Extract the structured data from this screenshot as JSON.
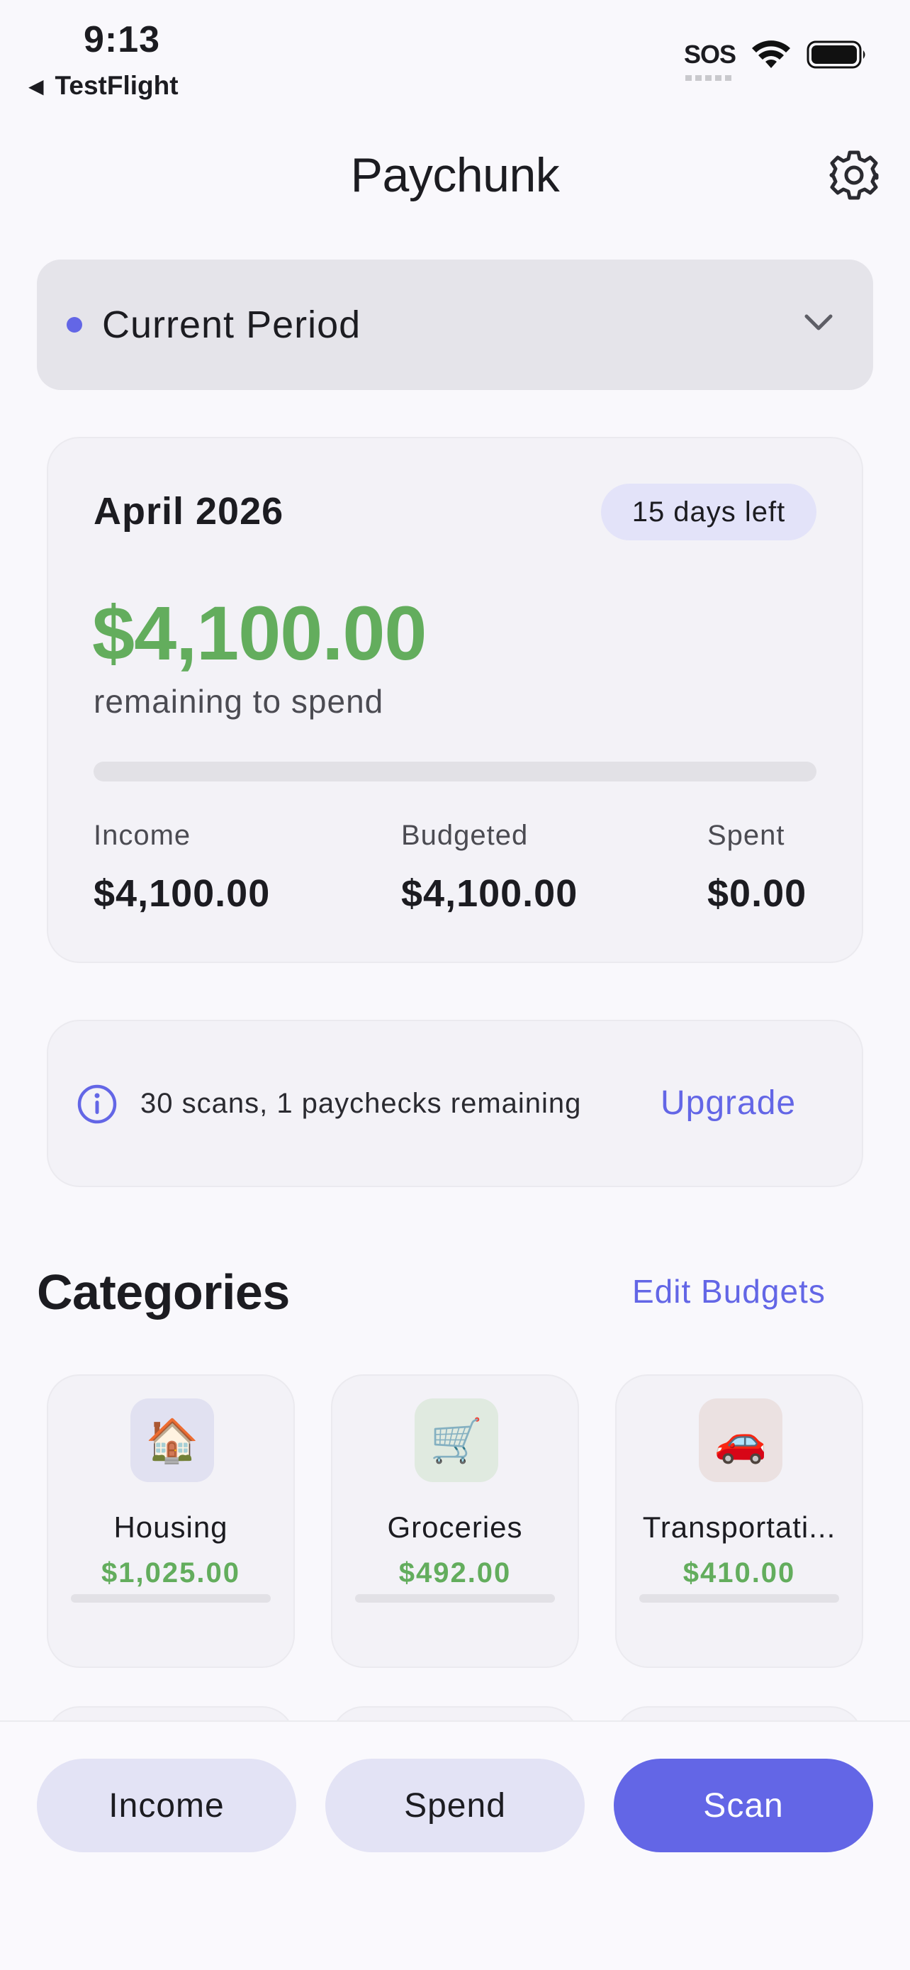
{
  "status_bar": {
    "time": "9:13",
    "back_label": "TestFlight",
    "back_icon": "back-triangle-icon",
    "carrier_text": "SOS",
    "wifi_icon": "wifi-icon",
    "battery_icon": "battery-icon"
  },
  "header": {
    "title": "Paychunk",
    "settings_icon": "gear-icon"
  },
  "period_selector": {
    "label": "Current Period",
    "indicator_color": "#6366e6",
    "chevron_icon": "chevron-down-icon"
  },
  "summary": {
    "month": "April 2026",
    "days_left": "15 days left",
    "remaining_amount": "$4,100.00",
    "remaining_label": "remaining to spend",
    "spent_fraction": 0,
    "stats": [
      {
        "label": "Income",
        "value": "$4,100.00"
      },
      {
        "label": "Budgeted",
        "value": "$4,100.00"
      },
      {
        "label": "Spent",
        "value": "$0.00"
      }
    ]
  },
  "limits": {
    "icon": "info-icon",
    "text": "30 scans, 1 paychecks remaining",
    "upgrade_label": "Upgrade"
  },
  "categories": {
    "title": "Categories",
    "edit_label": "Edit Budgets",
    "items": [
      {
        "name": "Housing",
        "amount": "$1,025.00",
        "emoji": "🏠",
        "icon": "house-icon",
        "icon_bg": "#e1e1f1",
        "spent_fraction": 0
      },
      {
        "name": "Groceries",
        "amount": "$492.00",
        "emoji": "🛒",
        "icon": "shopping-cart-icon",
        "icon_bg": "#e0eae0",
        "spent_fraction": 0
      },
      {
        "name": "Transportati...",
        "amount": "$410.00",
        "emoji": "🚗",
        "icon": "car-icon",
        "icon_bg": "#ebe1e1",
        "spent_fraction": 0
      }
    ]
  },
  "actions": {
    "income_label": "Income",
    "spend_label": "Spend",
    "scan_label": "Scan"
  },
  "colors": {
    "accent": "#6366e6",
    "positive": "#63ad5d",
    "card_bg": "#f3f2f7",
    "page_bg": "#f9f8fc"
  }
}
